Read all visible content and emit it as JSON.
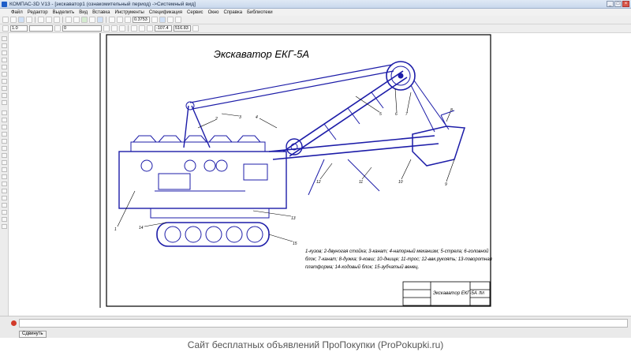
{
  "window": {
    "title": "КОМПАС-3D V13 - [экскаватор1 (ознакомительный период) ->Системный вид]",
    "controls": [
      "_",
      "□",
      "×"
    ]
  },
  "menu": {
    "items": [
      "Файл",
      "Редактор",
      "Выделить",
      "Вид",
      "Вставка",
      "Инструменты",
      "Спецификация",
      "Сервис",
      "Окно",
      "Справка",
      "Библиотеки"
    ]
  },
  "toolbar2": {
    "line_scale": "1.0",
    "layer": "0",
    "zoom": "0.3753",
    "coord_x": "-107.4",
    "coord_y": "516.83"
  },
  "drawing": {
    "title": "Экскаватор ЕКГ-5А",
    "legend_line1": "1-кузов; 2-двуногая стойка; 3-канат; 4-напорный механизм; 5-стрела; 6-головной",
    "legend_line2": "блок; 7-канат; 8-дужка; 9-ковш; 10-днище; 11-трос; 12-ввк.рукоять; 13-поворотная",
    "legend_line3": "платформа; 14-ходовый блок; 15-зубчатый венец.",
    "stamp_name": "Экскаватор ЕКГ-5А",
    "stamp_sheet": "ЛИ",
    "callouts": [
      "1",
      "2",
      "3",
      "4",
      "5",
      "6",
      "7",
      "8",
      "9",
      "10",
      "11",
      "12",
      "13",
      "14",
      "15"
    ]
  },
  "status": {
    "button": "Сдвинуть"
  },
  "watermark": "Сайт бесплатных объявлений ПроПокупки (ProPokupki.ru)",
  "colors": {
    "drawing_line": "#1c1ca8",
    "frame": "#000000",
    "titlebar": "#c9d8ec"
  }
}
